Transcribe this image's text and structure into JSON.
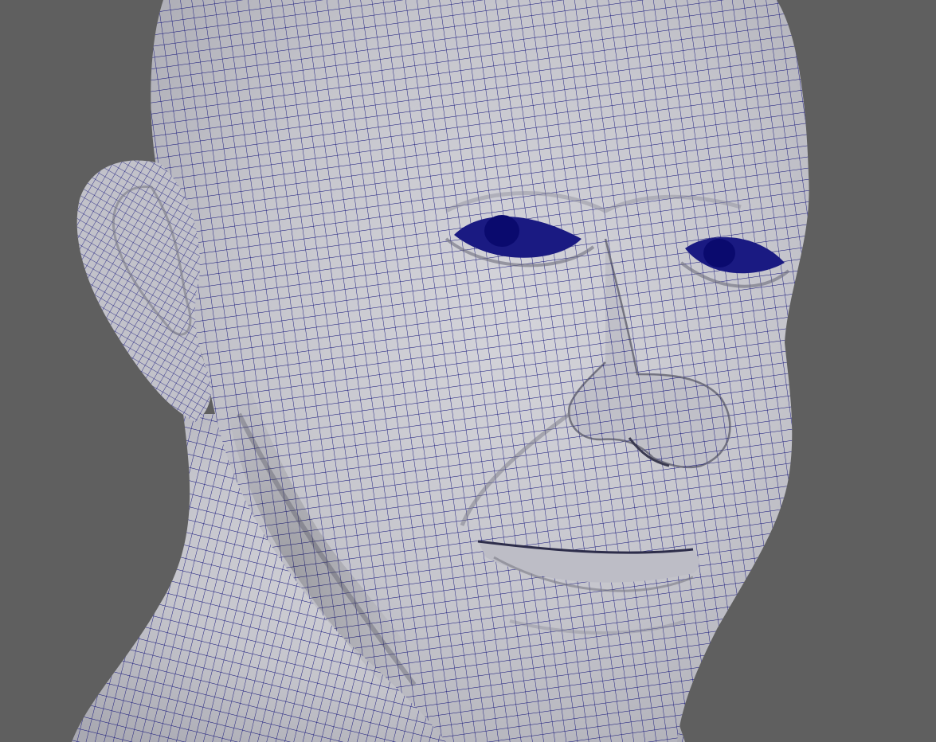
{
  "viewport": {
    "background_color": "#5f5f5f",
    "wire_color": "#0f0f78",
    "skin_color": "#c9c9d0",
    "display_mode": "wireframe-on-shaded",
    "subject": "head-model"
  }
}
